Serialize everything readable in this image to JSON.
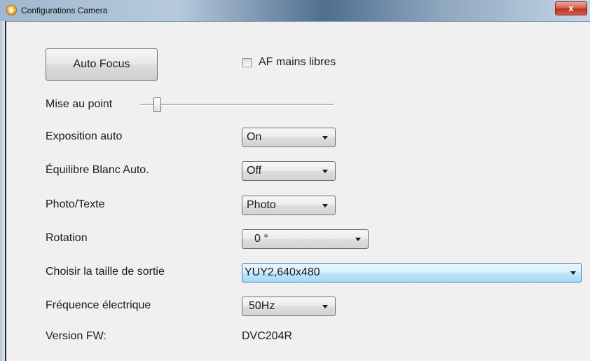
{
  "window": {
    "title": "Configurations Camera",
    "close_label": "x"
  },
  "controls": {
    "auto_focus_button": "Auto Focus",
    "af_hands_free": {
      "label": "AF mains libres",
      "checked": false
    },
    "focus": {
      "label": "Mise au point",
      "slider_value_fraction": 0.07
    },
    "auto_exposure": {
      "label": "Exposition auto",
      "value": "On"
    },
    "auto_white_balance": {
      "label": "Équilibre Blanc Auto.",
      "value": "Off"
    },
    "photo_text": {
      "label": "Photo/Texte",
      "value": "Photo"
    },
    "rotation": {
      "label": "Rotation",
      "value": "0 °"
    },
    "output_size": {
      "label": "Choisir la taille de sortie",
      "value": "YUY2,640x480"
    },
    "power_frequency": {
      "label": "Fréquence électrique",
      "value": "50Hz"
    },
    "firmware": {
      "label": "Version FW:",
      "value": "DVC204R"
    }
  },
  "colors": {
    "close_button": "#c2321f",
    "focused_combo": "#bee6fd",
    "window_background": "#f0f0f0"
  }
}
